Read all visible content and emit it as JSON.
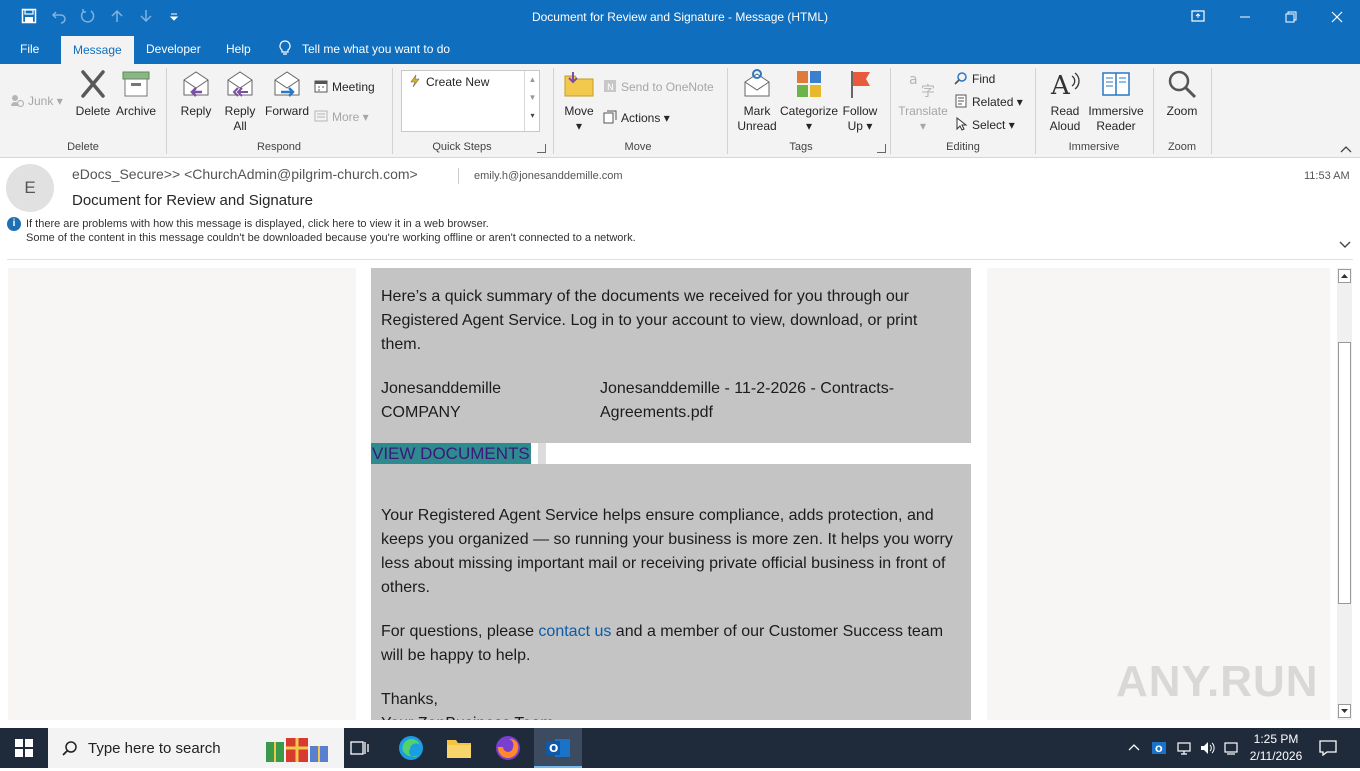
{
  "window": {
    "title": "Document for Review and Signature  -  Message (HTML)"
  },
  "quick_access": {
    "icons": [
      "save-icon",
      "undo-icon",
      "redo-icon",
      "up-arrow-icon",
      "down-arrow-icon",
      "customize-icon"
    ]
  },
  "tabs": [
    {
      "label": "File"
    },
    {
      "label": "Message"
    },
    {
      "label": "Developer"
    },
    {
      "label": "Help"
    }
  ],
  "tell_me": "Tell me what you want to do",
  "ribbon": {
    "delete_group": {
      "junk": "Junk",
      "delete": "Delete",
      "archive": "Archive",
      "label": "Delete"
    },
    "respond_group": {
      "reply": "Reply",
      "reply_all_1": "Reply",
      "reply_all_2": "All",
      "forward": "Forward",
      "meeting": "Meeting",
      "more": "More",
      "label": "Respond"
    },
    "quicksteps_group": {
      "create_new": "Create New",
      "label": "Quick Steps"
    },
    "move_group": {
      "move": "Move",
      "send_onenote": "Send to OneNote",
      "actions": "Actions",
      "label": "Move"
    },
    "tags_group": {
      "mark_unread_1": "Mark",
      "mark_unread_2": "Unread",
      "categorize": "Categorize",
      "follow_up_1": "Follow",
      "follow_up_2": "Up",
      "label": "Tags"
    },
    "editing_group": {
      "translate": "Translate",
      "find": "Find",
      "related": "Related",
      "select": "Select",
      "label": "Editing"
    },
    "immersive_group": {
      "read_aloud_1": "Read",
      "read_aloud_2": "Aloud",
      "immersive_reader_1": "Immersive",
      "immersive_reader_2": "Reader",
      "label": "Immersive"
    },
    "zoom_group": {
      "zoom": "Zoom",
      "label": "Zoom"
    }
  },
  "message": {
    "avatar_initial": "E",
    "sender": "eDocs_Secure>> <ChurchAdmin@pilgrim-church.com>",
    "recipient": "emily.h@jonesanddemille.com",
    "time": "11:53 AM",
    "subject": "Document for Review and Signature",
    "info_line_1": "If there are problems with how this message is displayed, click here to view it in a web browser.",
    "info_line_2": "Some of the content in this message couldn't be downloaded because you're working offline or aren't connected to a network."
  },
  "body": {
    "intro": "Here’s a quick summary of the documents we received for you through our Registered Agent Service. Log in to your account to view, download, or print them.",
    "company_label": "Jonesanddemille COMPANY",
    "document_name": "Jonesanddemille - 11-2-2026 - Contracts-Agreements.pdf",
    "view_button": "VIEW DOCUMENTS",
    "para2": "Your Registered Agent Service helps ensure compliance, adds protection, and keeps you organized — so running your business is more zen. It helps you worry less about missing important mail or receiving private official business in front of others.",
    "questions_pre": "For questions, please ",
    "contact_link": "contact us",
    "questions_post": " and a member of our Customer Success team will be happy to help.",
    "thanks": "Thanks,",
    "signature_partial": "Your ZenBusiness Team"
  },
  "watermark": "ANY.RUN",
  "taskbar": {
    "search_placeholder": "Type here to search",
    "time": "1:25 PM",
    "date": "2/11/2026"
  },
  "colors": {
    "brand_blue": "#106ebe",
    "ribbon_bg": "#f3f3f3",
    "body_gray": "#c4c4c4",
    "link_blue": "#0b5ca8",
    "button_teal": "#2e8a8e",
    "button_text": "#3a1a78",
    "taskbar": "#1f2a3a"
  }
}
